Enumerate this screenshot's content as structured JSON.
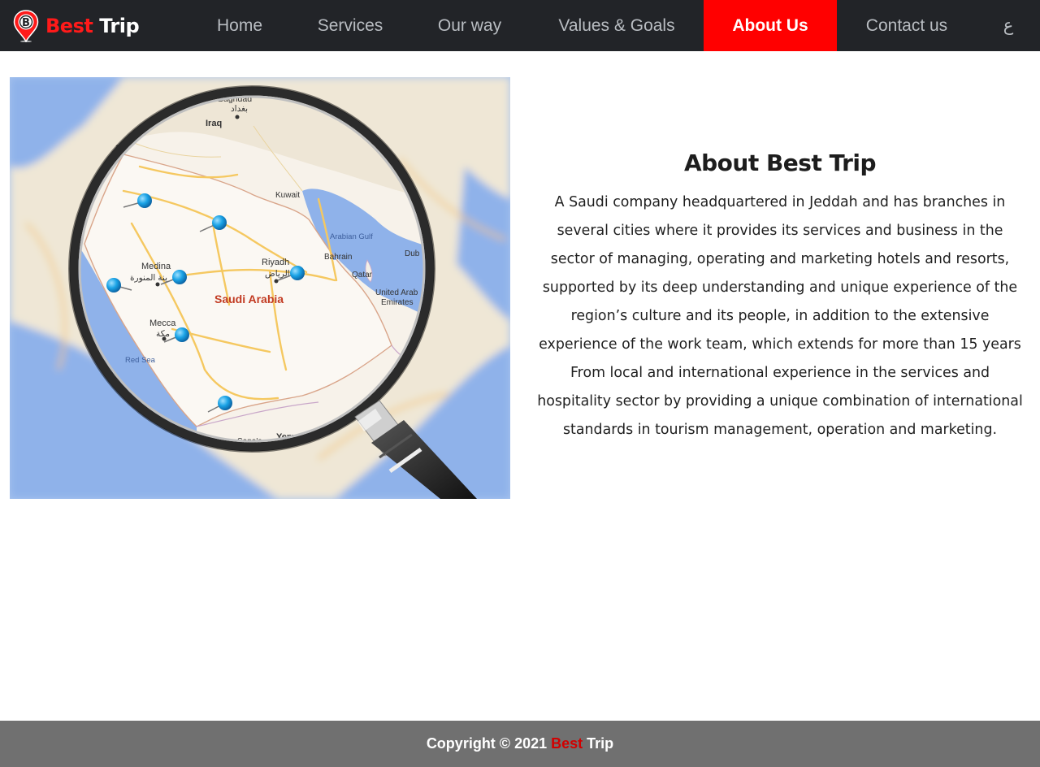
{
  "brand": {
    "logo_letter": "B",
    "name_part1": "Best",
    "name_part2": "Trip",
    "colors": {
      "accent": "#ff1a1a",
      "text": "#ffffff"
    }
  },
  "nav": {
    "items": [
      {
        "label": "Home",
        "active": false
      },
      {
        "label": "Services",
        "active": false
      },
      {
        "label": "Our way",
        "active": false
      },
      {
        "label": "Values & Goals",
        "active": false
      },
      {
        "label": "About Us",
        "active": true
      },
      {
        "label": "Contact us",
        "active": false
      }
    ],
    "language_toggle": "ع",
    "colors": {
      "background": "#222428",
      "active_background": "#ff0000",
      "text": "#b9bdc2"
    }
  },
  "map_image": {
    "labels": {
      "baghdad_en": "Baghdad",
      "baghdad_ar": "بغداد",
      "iraq": "Iraq",
      "kuwait": "Kuwait",
      "arabian_gulf": "Arabian Gulf",
      "bahrain": "Bahrain",
      "qatar": "Qatar",
      "uae_line1": "United Arab",
      "uae_line2": "Emirates",
      "dubai": "Dub",
      "riyadh_en": "Riyadh",
      "riyadh_ar": "الرياض",
      "medina_en": "Medina",
      "medina_ar": "ينة المنورة",
      "mecca_en": "Mecca",
      "mecca_ar": "مكة",
      "red_sea": "Red Sea",
      "saudi_arabia": "Saudi Arabia",
      "sanaa": "Sana'a",
      "yemen": "Yem",
      "jordan_partial": "an"
    },
    "icons": [
      "magnifying-glass-icon",
      "map-pin-icon"
    ]
  },
  "about": {
    "title": "About Best Trip",
    "body": "A Saudi company headquartered in Jeddah and has branches in several cities where it provides its services and business in the sector of managing, operating and marketing hotels and resorts, supported by its deep understanding and unique experience of the region’s culture and its people, in addition to the extensive experience of the work team, which extends for more than 15 years From local and international experience in the services and hospitality sector by providing a unique combination of international standards in tourism management, operation and marketing."
  },
  "footer": {
    "copyright_prefix": "Copyright © 2021",
    "brand_part1": "Best",
    "brand_part2": "Trip",
    "colors": {
      "background": "#707070",
      "brand_accent": "#d10000"
    }
  }
}
